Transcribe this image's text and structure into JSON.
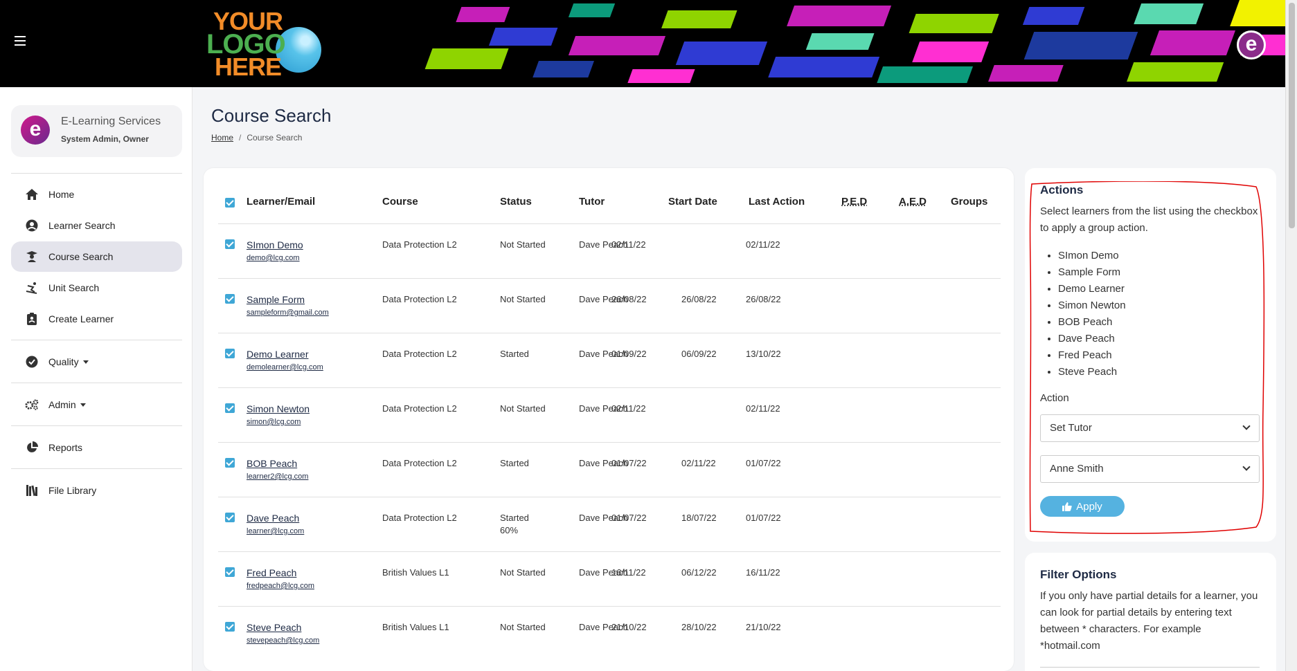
{
  "header": {
    "logo_line1": "YOUR",
    "logo_line2": "LOGO",
    "logo_line3": "HERE",
    "brand_glyph": "e",
    "banner_colors": [
      "#c61fb8",
      "#2f3bd3",
      "#8fd400",
      "#0c9b7c",
      "#f2f200",
      "#ff2fd2",
      "#1d3a9e",
      "#5ad9b0"
    ]
  },
  "sidebar": {
    "org": {
      "glyph": "e",
      "name": "E-Learning Services",
      "role": "System Admin, Owner"
    },
    "items": [
      {
        "label": "Home",
        "icon": "home-icon"
      },
      {
        "label": "Learner Search",
        "icon": "user-circle-icon"
      },
      {
        "label": "Course Search",
        "icon": "graduate-icon",
        "active": true
      },
      {
        "label": "Unit Search",
        "icon": "skier-icon"
      },
      {
        "label": "Create Learner",
        "icon": "clipboard-user-icon"
      },
      {
        "label": "Quality",
        "icon": "check-circle-icon"
      },
      {
        "label": "Admin",
        "icon": "cogs-icon"
      },
      {
        "label": "Reports",
        "icon": "pie-chart-icon"
      },
      {
        "label": "File Library",
        "icon": "book-library-icon"
      }
    ]
  },
  "page": {
    "title": "Course Search",
    "breadcrumb": {
      "home": "Home",
      "current": "Course Search"
    }
  },
  "table": {
    "headers": [
      "Learner/Email",
      "Course",
      "Status",
      "Tutor",
      "Start Date",
      "Last Action",
      "P.E.D",
      "A.E.D",
      "Groups"
    ],
    "rows": [
      {
        "name": "SImon Demo",
        "email": "demo@lcg.com",
        "course": "Data Protection L2",
        "status": "Not Started",
        "status2": "",
        "tutor": "Dave Peach",
        "start": "02/11/22",
        "last": "",
        "ped": "02/11/22",
        "aed": "",
        "groups": ""
      },
      {
        "name": "Sample Form",
        "email": "sampleform@gmail.com",
        "course": "Data Protection L2",
        "status": "Not Started",
        "status2": "",
        "tutor": "Dave Peach",
        "start": "26/08/22",
        "last": "26/08/22",
        "ped": "26/08/22",
        "aed": "",
        "groups": ""
      },
      {
        "name": "Demo Learner",
        "email": "demolearner@lcg.com",
        "course": "Data Protection L2",
        "status": "Started",
        "status2": "",
        "tutor": "Dave Peach",
        "start": "01/09/22",
        "last": "06/09/22",
        "ped": "13/10/22",
        "aed": "",
        "groups": ""
      },
      {
        "name": "Simon Newton",
        "email": "simon@lcg.com",
        "course": "Data Protection L2",
        "status": "Not Started",
        "status2": "",
        "tutor": "Dave Peach",
        "start": "02/11/22",
        "last": "",
        "ped": "02/11/22",
        "aed": "",
        "groups": ""
      },
      {
        "name": "BOB Peach",
        "email": "learner2@lcg.com",
        "course": "Data Protection L2",
        "status": "Started",
        "status2": "",
        "tutor": "Dave Peach",
        "start": "01/07/22",
        "last": "02/11/22",
        "ped": "01/07/22",
        "aed": "",
        "groups": ""
      },
      {
        "name": "Dave Peach",
        "email": "learner@lcg.com",
        "course": "Data Protection L2",
        "status": "Started",
        "status2": "60%",
        "tutor": "Dave Peach",
        "start": "01/07/22",
        "last": "18/07/22",
        "ped": "01/07/22",
        "aed": "",
        "groups": ""
      },
      {
        "name": "Fred Peach",
        "email": "fredpeach@lcg.com",
        "course": "British Values L1",
        "status": "Not Started",
        "status2": "",
        "tutor": "Dave Peach",
        "start": "16/11/22",
        "last": "06/12/22",
        "ped": "16/11/22",
        "aed": "",
        "groups": ""
      },
      {
        "name": "Steve Peach",
        "email": "stevepeach@lcg.com",
        "course": "British Values L1",
        "status": "Not Started",
        "status2": "",
        "tutor": "Dave Peach",
        "start": "21/10/22",
        "last": "28/10/22",
        "ped": "21/10/22",
        "aed": "",
        "groups": ""
      }
    ]
  },
  "actions": {
    "title": "Actions",
    "description": "Select learners from the list using the checkbox to apply a group action.",
    "selected": [
      "SImon Demo",
      "Sample Form",
      "Demo Learner",
      "Simon Newton",
      "BOB Peach",
      "Dave Peach",
      "Fred Peach",
      "Steve Peach"
    ],
    "action_label": "Action",
    "action_value": "Set Tutor",
    "tutor_value": "Anne Smith",
    "apply_label": "Apply",
    "annotation_color": "#e00000"
  },
  "filter": {
    "title": "Filter Options",
    "description": "If you only have partial details for a learner, you can look for partial details by entering text between * characters. For example *hotmail.com"
  },
  "colors": {
    "accent": "#3fa7d6",
    "apply": "#55b2e0",
    "active_nav": "#e4e4ec",
    "title": "#1e2a44"
  }
}
